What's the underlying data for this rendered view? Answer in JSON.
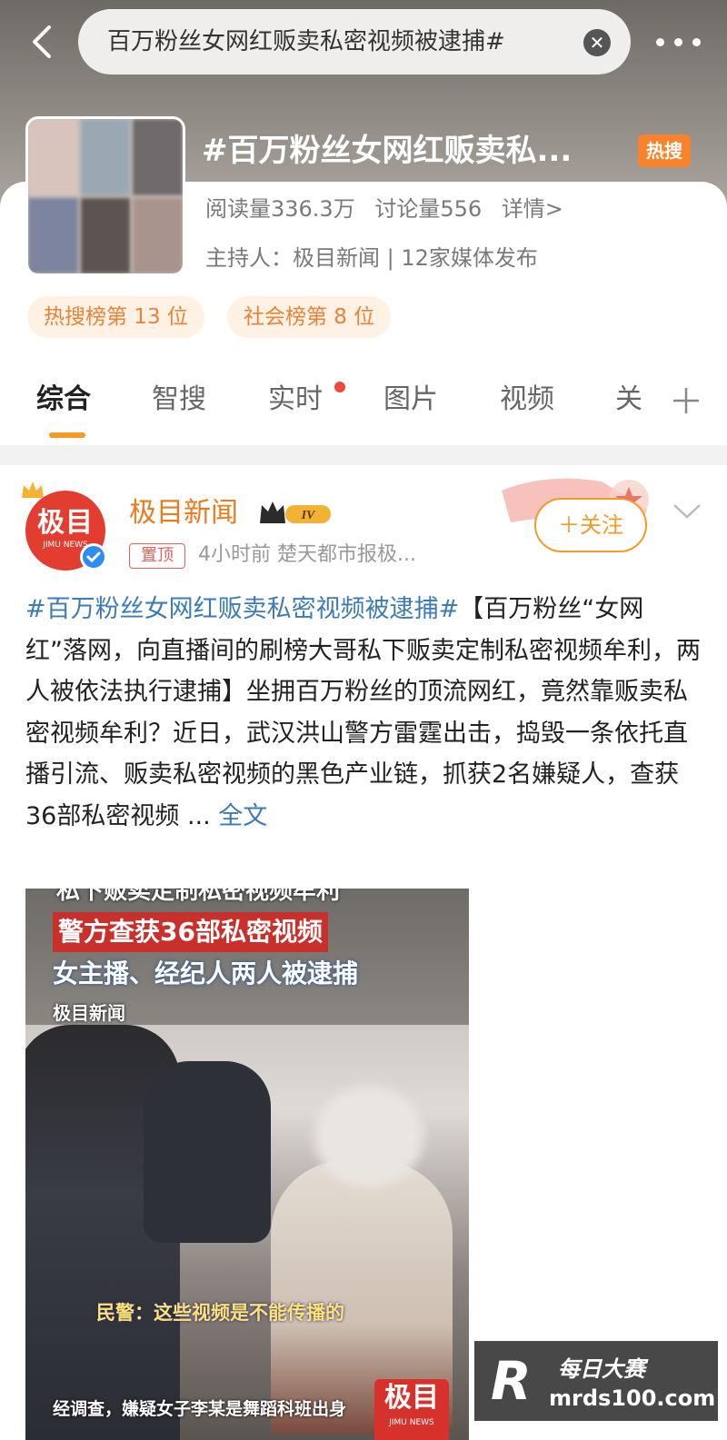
{
  "search": {
    "query": "百万粉丝女网红贩卖私密视频被逮捕#"
  },
  "topic": {
    "title": "#百万粉丝女网红贩卖私...",
    "hot_badge": "热搜",
    "reads": "阅读量336.3万",
    "discussions": "讨论量556",
    "details_link": "详情>",
    "host_line": "主持人：极目新闻 | 12家媒体发布",
    "rank_tags": [
      "热搜榜第 13 位",
      "社会榜第 8 位"
    ]
  },
  "tabs": [
    {
      "label": "综合",
      "active": true
    },
    {
      "label": "智搜",
      "active": false
    },
    {
      "label": "实时",
      "active": false,
      "has_dot": true
    },
    {
      "label": "图片",
      "active": false
    },
    {
      "label": "视频",
      "active": false
    },
    {
      "label": "关",
      "active": false
    }
  ],
  "post": {
    "avatar_text": "极目",
    "avatar_subtext": "JIMU NEWS",
    "author": "极目新闻",
    "level": "IV",
    "pin_label": "置顶",
    "meta": "4小时前   楚天都市报极...",
    "follow_label": "＋关注",
    "hashtag": "#百万粉丝女网红贩卖私密视频被逮捕#",
    "body": "【百万粉丝“女网红”落网，向直播间的刷榜大哥私下贩卖定制私密视频牟利，两人被依法执行逮捕】坐拥百万粉丝的顶流网红，竟然靠贩卖私密视频牟利？近日，武汉洪山警方雷霆出击，捣毁一条依托直播引流、贩卖私密视频的黑色产业链，抓获2名嫌疑人，查获36部私密视频 ... ",
    "more_label": "全文"
  },
  "media": {
    "caption_top": "私下贩卖定制私密视频牟利",
    "caption_red": "警方查获36部私密视频",
    "caption_blue": "女主播、经纪人两人被逮捕",
    "logo_text": "极目新闻",
    "quote": "民警：这些视频是不能传播的",
    "bottom_text": "经调查，嫌疑女子李某是舞蹈科班出身",
    "corner_logo": "极目",
    "corner_logo_sub": "JIMU NEWS"
  },
  "watermark": {
    "mark": "R",
    "top": "每日大赛",
    "bottom": "mrds100.com"
  },
  "colors": {
    "accent": "#f39b26",
    "author": "#ea7b1e",
    "link": "#3e7bb3",
    "hot": "#f9822c"
  }
}
